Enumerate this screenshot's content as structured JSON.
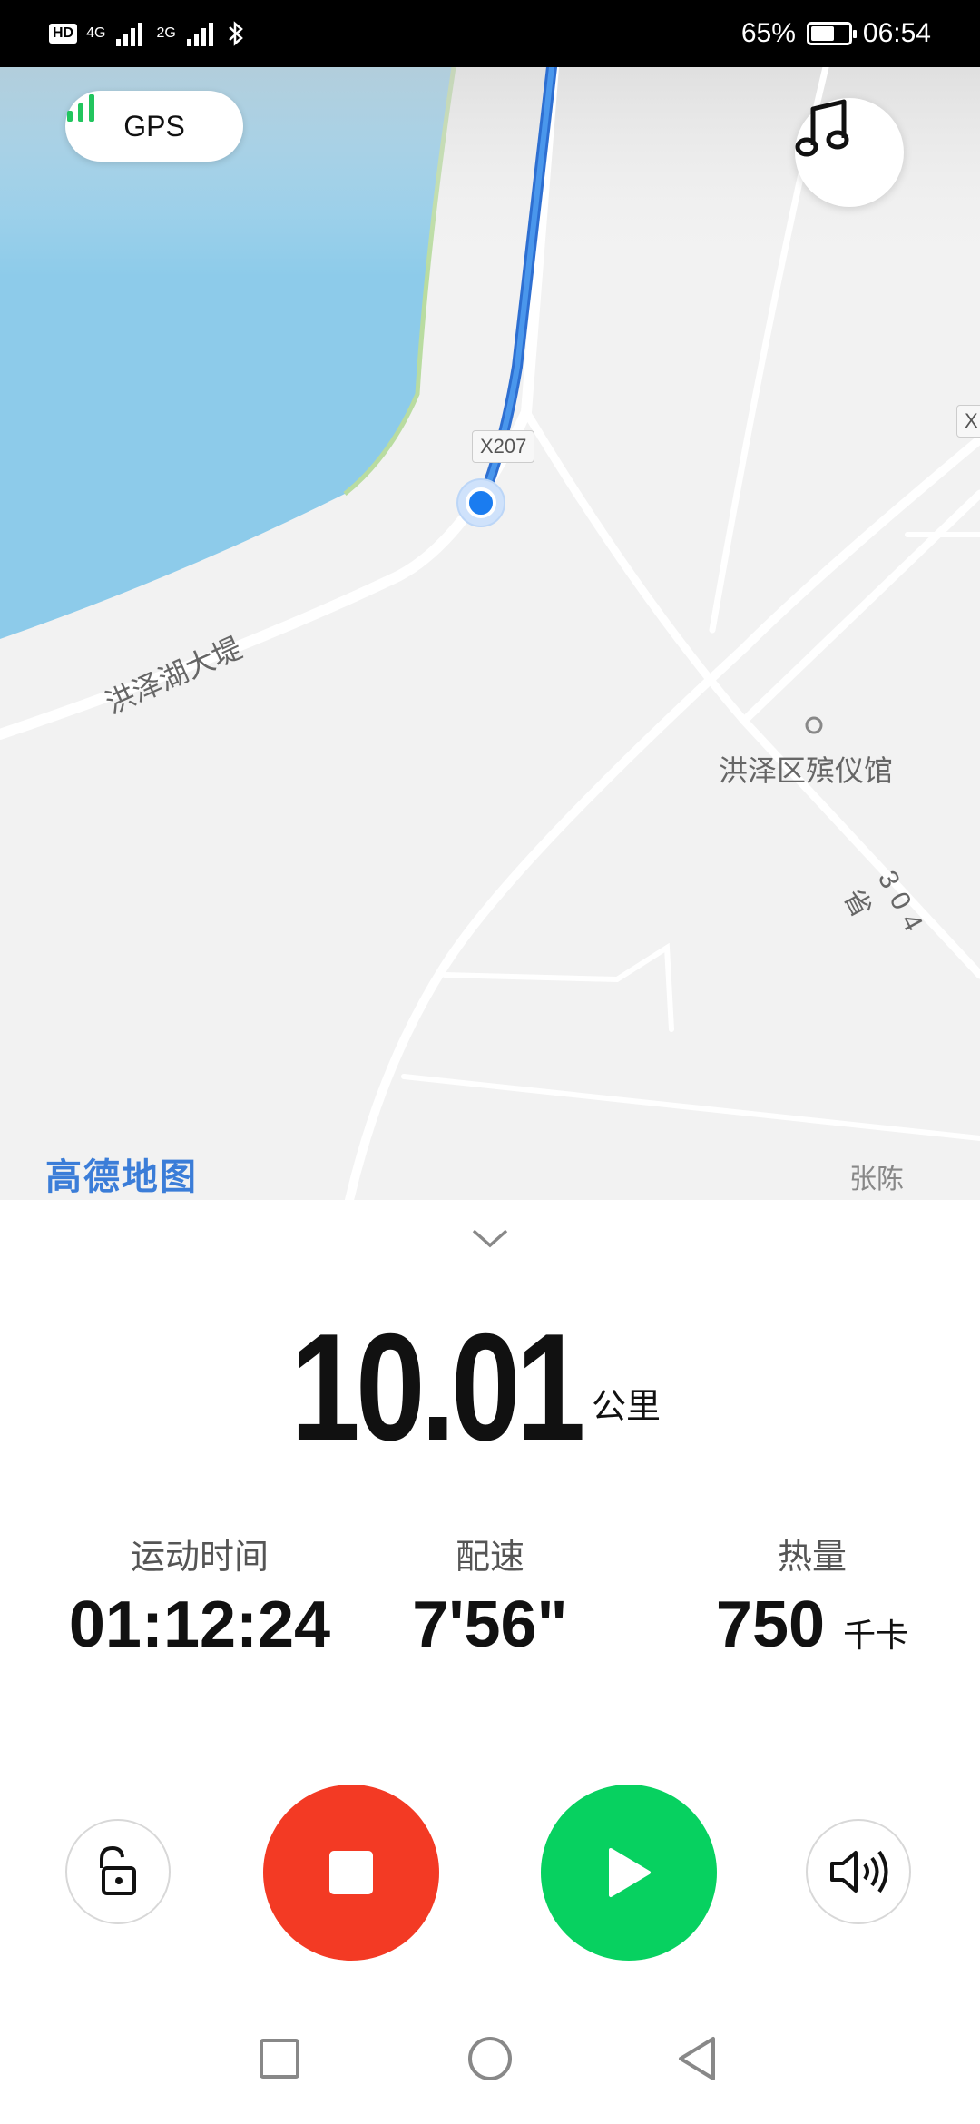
{
  "status_bar": {
    "left_badges": [
      "HD",
      "4G",
      "2G"
    ],
    "battery_percent_text": "65%",
    "battery_level": 0.65,
    "time": "06:54"
  },
  "map": {
    "gps_label": "GPS",
    "road_label_main": "洪泽湖大堤",
    "road_sign_1": "X207",
    "road_sign_2": "X",
    "poi_label": "洪泽区殡仪馆",
    "road_label_304": "304省",
    "place_label": "张陈",
    "watermark": "高德地图",
    "colors": {
      "water": "#8dcbea",
      "route": "#3a86e0",
      "land": "#f2f2f2"
    }
  },
  "workout": {
    "distance_value": "10.01",
    "distance_unit": "公里",
    "time_label": "运动时间",
    "time_value": "01:12:24",
    "pace_label": "配速",
    "pace_value": "7'56\"",
    "calorie_label": "热量",
    "calorie_value": "750",
    "calorie_unit": "千卡"
  },
  "controls": {
    "colors": {
      "stop": "#f33a24",
      "play": "#07d160"
    },
    "icons": [
      "unlock-icon",
      "stop-icon",
      "play-icon",
      "volume-icon"
    ]
  },
  "navbar": {
    "icons": [
      "recent-apps-icon",
      "home-icon",
      "back-icon"
    ]
  }
}
